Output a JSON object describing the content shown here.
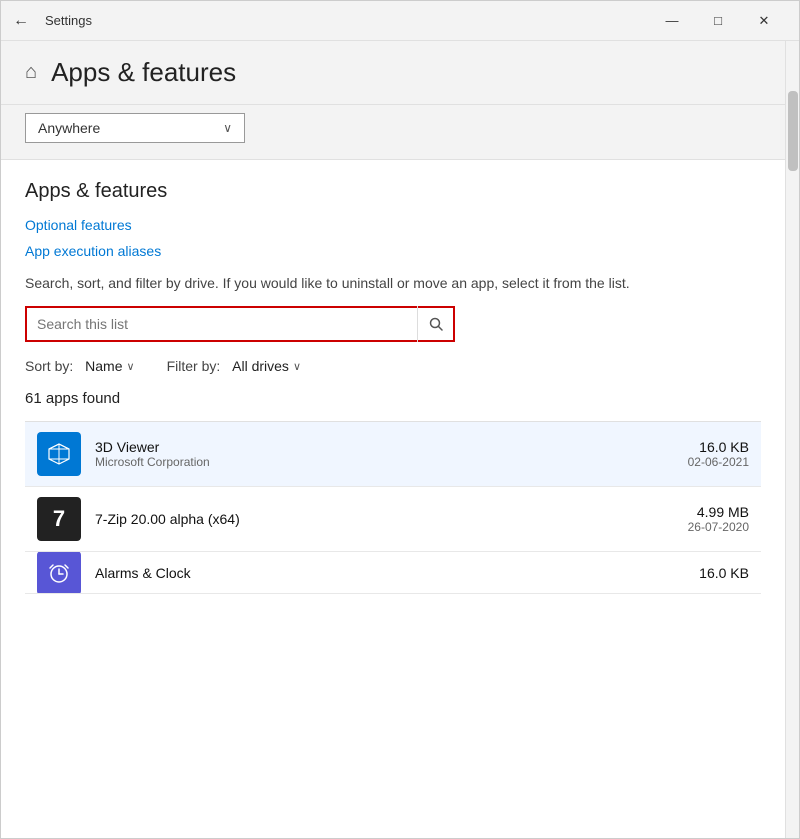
{
  "window": {
    "title": "Settings",
    "back_label": "←",
    "min_label": "—",
    "max_label": "□",
    "close_label": "✕"
  },
  "header": {
    "home_icon": "⌂",
    "title": "Apps & features"
  },
  "filter_dropdown": {
    "value": "Anywhere",
    "arrow": "∨"
  },
  "section": {
    "title": "Apps & features",
    "optional_features_label": "Optional features",
    "app_execution_aliases_label": "App execution aliases",
    "description": "Search, sort, and filter by drive. If you would like to uninstall or move an app, select it from the list.",
    "search_placeholder": "Search this list"
  },
  "sort_filter": {
    "sort_label": "Sort by:",
    "sort_value": "Name",
    "filter_label": "Filter by:",
    "filter_value": "All drives",
    "chevron": "∨"
  },
  "apps_count": {
    "count": "61",
    "label": "apps found"
  },
  "apps": [
    {
      "name": "3D Viewer",
      "publisher": "Microsoft Corporation",
      "size": "16.0 KB",
      "date": "02-06-2021",
      "icon_type": "3dviewer"
    },
    {
      "name": "7-Zip 20.00 alpha (x64)",
      "publisher": "",
      "size": "4.99 MB",
      "date": "26-07-2020",
      "icon_type": "7zip"
    },
    {
      "name": "Alarms & Clock",
      "publisher": "",
      "size": "16.0 KB",
      "date": "",
      "icon_type": "alarms"
    }
  ]
}
